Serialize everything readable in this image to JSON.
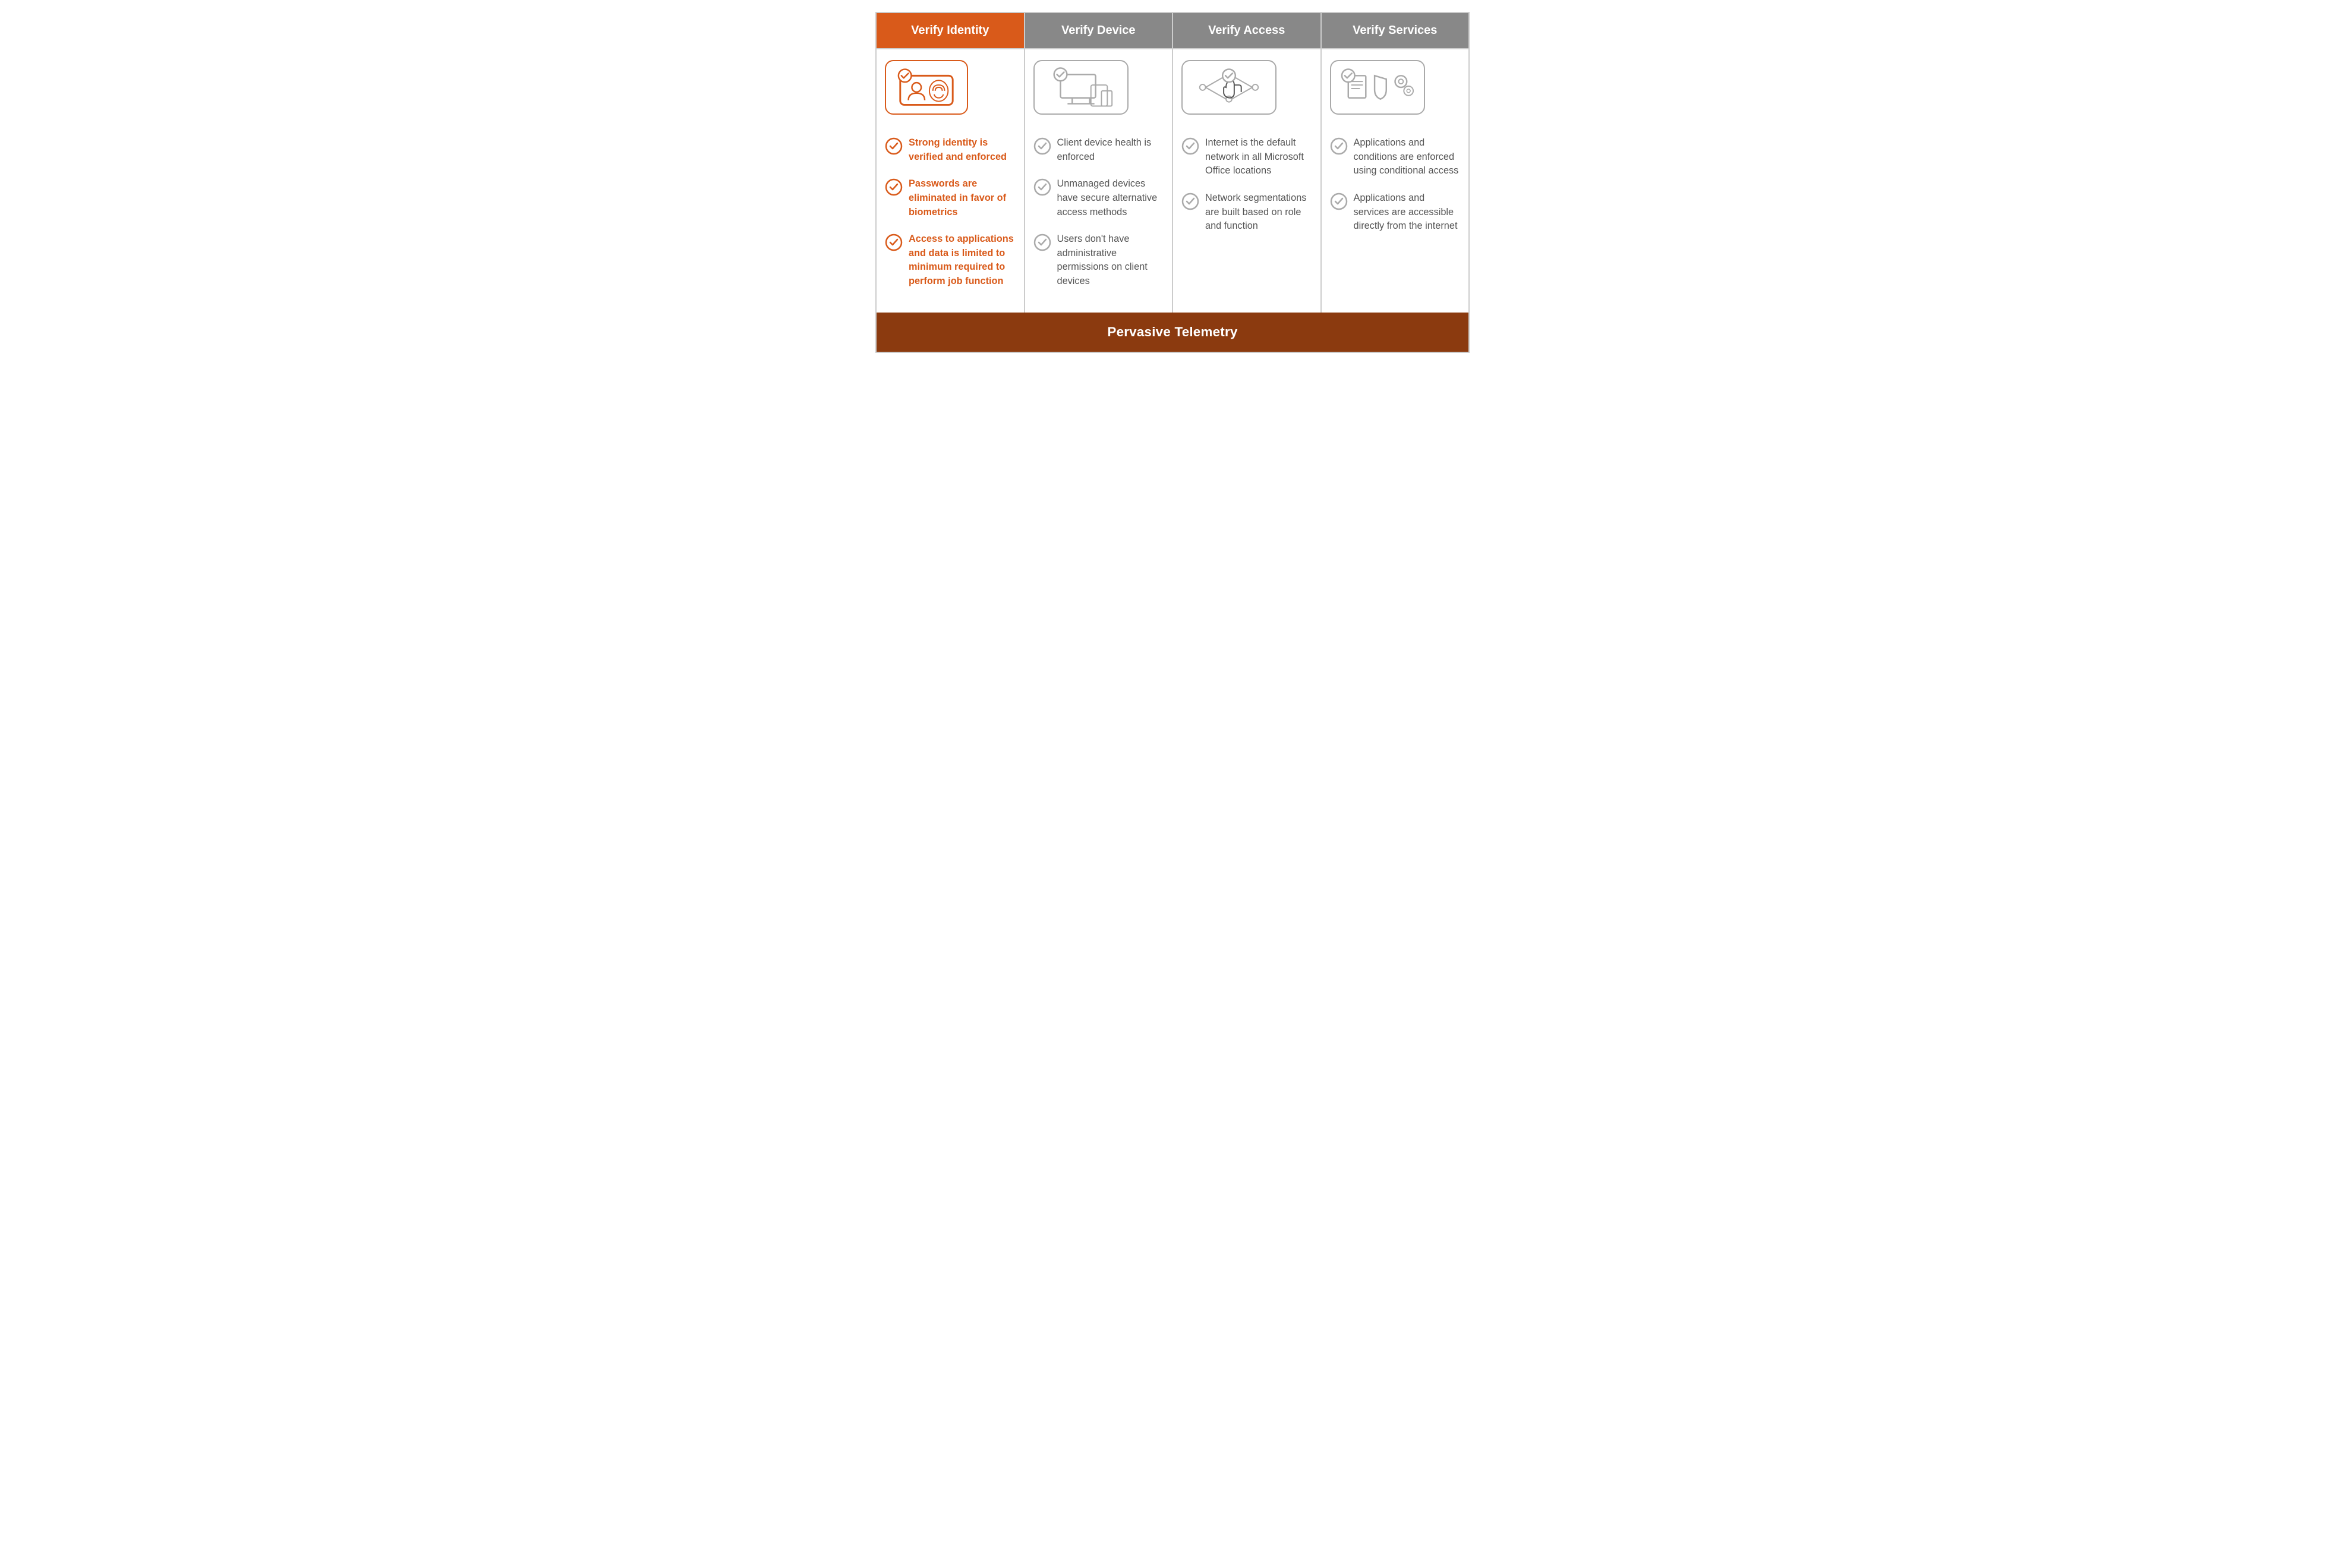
{
  "headers": [
    {
      "id": "identity",
      "label": "Verify Identity",
      "orange": true
    },
    {
      "id": "device",
      "label": "Verify Device",
      "orange": false
    },
    {
      "id": "access",
      "label": "Verify Access",
      "orange": false
    },
    {
      "id": "services",
      "label": "Verify Services",
      "orange": false
    }
  ],
  "columns": {
    "identity": {
      "items": [
        {
          "text": "Strong identity is verified and enforced",
          "orange": true
        },
        {
          "text": "Passwords are eliminated in favor of biometrics",
          "orange": true
        },
        {
          "text": "Access to applications and data is limited to minimum required to perform job function",
          "orange": true
        }
      ]
    },
    "device": {
      "items": [
        {
          "text": "Client device health is enforced",
          "orange": false
        },
        {
          "text": "Unmanaged devices have secure alternative access methods",
          "orange": false
        },
        {
          "text": "Users don't have administrative permissions on client devices",
          "orange": false
        }
      ]
    },
    "access": {
      "items": [
        {
          "text": "Internet is the default network in all Microsoft Office locations",
          "orange": false
        },
        {
          "text": "Network segmentations are built based on role and function",
          "orange": false
        }
      ]
    },
    "services": {
      "items": [
        {
          "text": "Applications and conditions are enforced using conditional access",
          "orange": false
        },
        {
          "text": "Applications and services are accessible directly from the internet",
          "orange": false
        }
      ]
    }
  },
  "footer": {
    "label": "Pervasive Telemetry"
  }
}
